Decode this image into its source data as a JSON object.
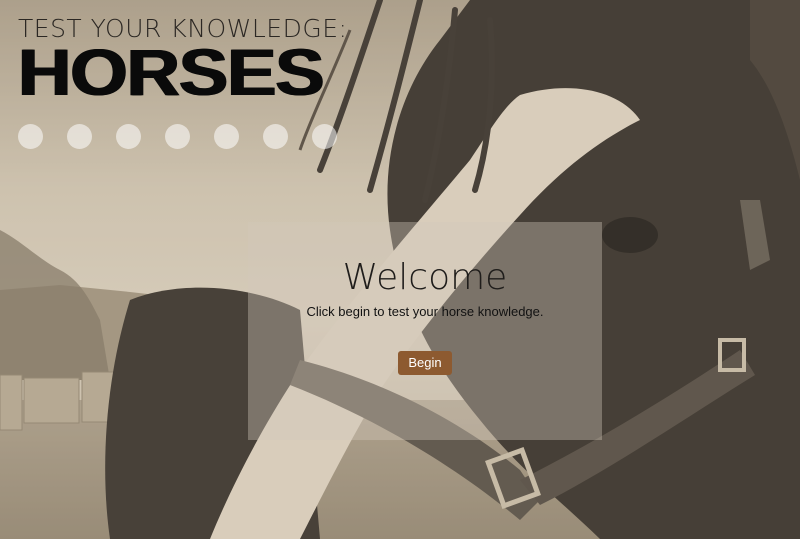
{
  "header": {
    "kicker": "TEST YOUR KNOWLEDGE:",
    "title": "HORSES"
  },
  "progress": {
    "total_questions": 7,
    "answered": 0
  },
  "welcome": {
    "heading": "Welcome",
    "subtitle": "Click begin to test your horse knowledge.",
    "button_label": "Begin"
  },
  "colors": {
    "button": "#8d5a30",
    "sepia_background": "#b9ac98"
  },
  "background_image": "sepia photo of a horse face wearing a halter"
}
